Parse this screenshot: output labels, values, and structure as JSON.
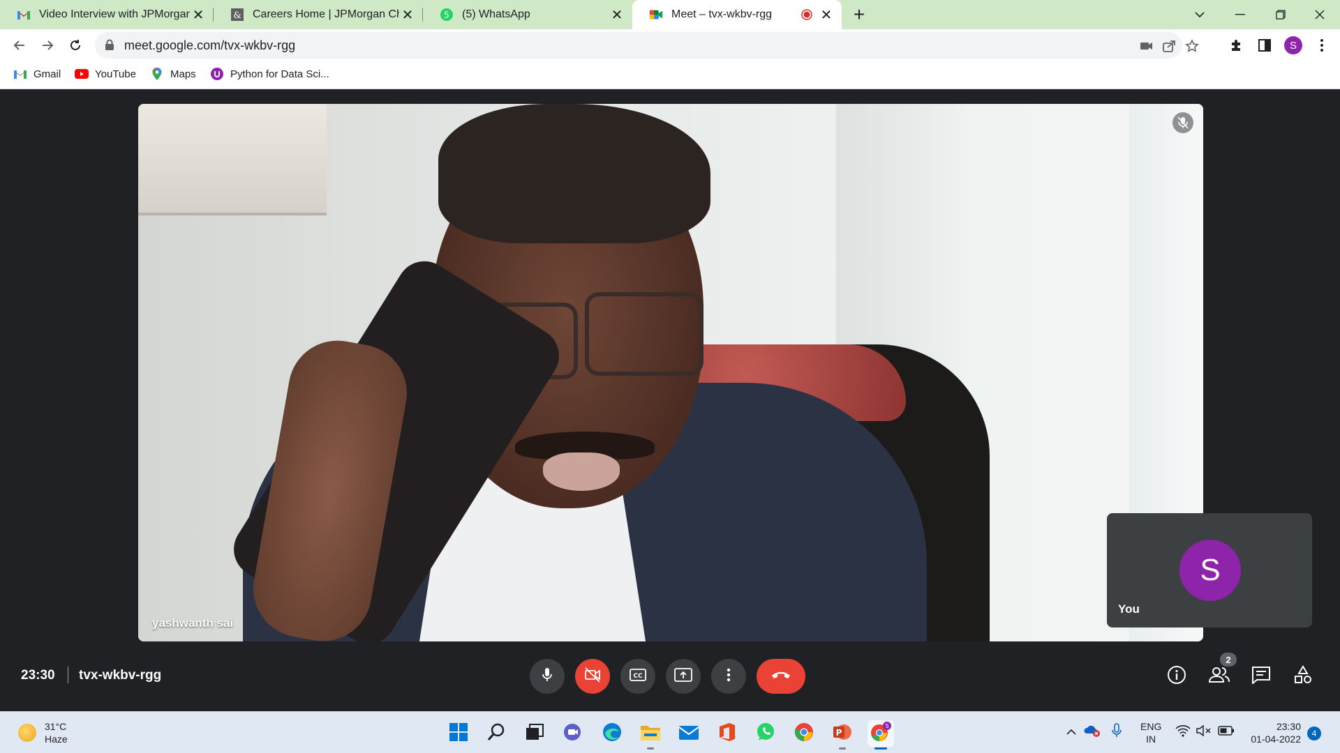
{
  "tabs": [
    {
      "title": "Video Interview with JPMorgan C",
      "favicon": "gmail-icon"
    },
    {
      "title": "Careers Home | JPMorgan Chase",
      "favicon": "jpmorgan-icon"
    },
    {
      "title": "(5) WhatsApp",
      "favicon": "whatsapp-icon"
    },
    {
      "title": "Meet – tvx-wkbv-rgg",
      "favicon": "meet-icon",
      "active": true,
      "recording": true
    }
  ],
  "address_bar": {
    "url": "meet.google.com/tvx-wkbv-rgg"
  },
  "profile": {
    "initial": "S",
    "color": "#8e24aa"
  },
  "bookmarks": [
    {
      "label": "Gmail",
      "icon": "gmail-icon"
    },
    {
      "label": "YouTube",
      "icon": "youtube-icon"
    },
    {
      "label": "Maps",
      "icon": "maps-icon"
    },
    {
      "label": "Python for Data Sci...",
      "icon": "course-icon"
    }
  ],
  "meet": {
    "main_participant": "yashwanth sai",
    "self_tile": {
      "label": "You",
      "initial": "S"
    },
    "time": "23:30",
    "meeting_code": "tvx-wkbv-rgg",
    "participant_count": "2",
    "colors": {
      "end_call": "#ea4335",
      "avatar": "#8e24aa",
      "background": "#202124"
    }
  },
  "taskbar": {
    "weather": {
      "temp": "31°C",
      "condition": "Haze"
    },
    "language": {
      "line1": "ENG",
      "line2": "IN"
    },
    "clock": {
      "time": "23:30",
      "date": "01-04-2022"
    },
    "notifications": "4"
  }
}
